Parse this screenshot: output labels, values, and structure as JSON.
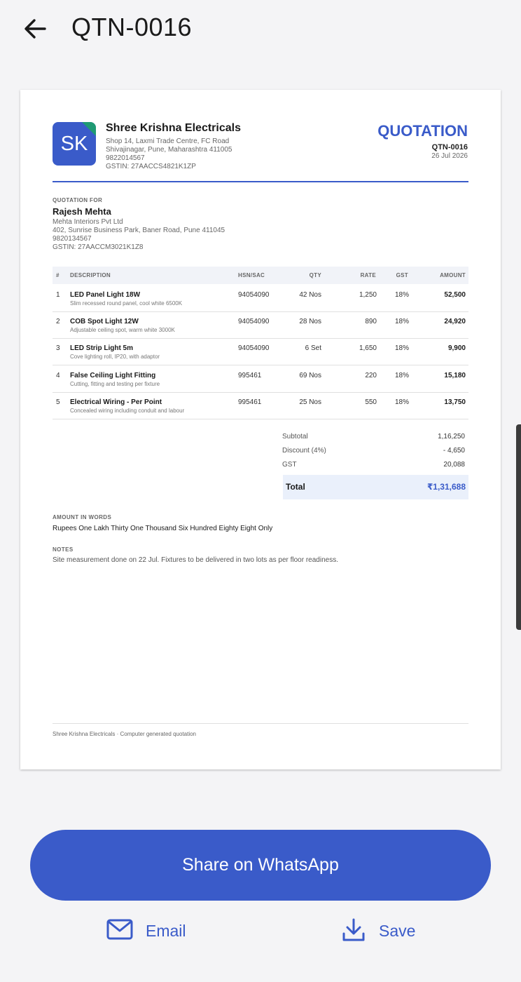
{
  "header": {
    "title": "QTN-0016"
  },
  "business": {
    "logo_text": "SK",
    "name": "Shree Krishna Electricals",
    "address1": "Shop 14, Laxmi Trade Centre, FC Road",
    "address2": "Shivajinagar, Pune, Maharashtra 411005",
    "phone": "9822014567",
    "gstin": "GSTIN: 27AACCS4821K1ZP"
  },
  "document": {
    "type": "QUOTATION",
    "number": "QTN-0016",
    "date": "26 Jul 2026"
  },
  "customer": {
    "label": "QUOTATION FOR",
    "name": "Rajesh Mehta",
    "company": "Mehta Interiors Pvt Ltd",
    "address": "402, Sunrise Business Park, Baner Road, Pune 411045",
    "phone": "9820134567",
    "gstin": "GSTIN: 27AACCM3021K1Z8"
  },
  "table": {
    "headers": {
      "no": "#",
      "desc": "DESCRIPTION",
      "hsn": "HSN/SAC",
      "qty": "QTY",
      "rate": "RATE",
      "gst": "GST",
      "amount": "AMOUNT"
    },
    "rows": [
      {
        "no": "1",
        "item": "LED Panel Light 18W",
        "desc": "Slim recessed round panel, cool white 6500K",
        "hsn": "94054090",
        "qty": "42 Nos",
        "rate": "1,250",
        "gst": "18%",
        "amount": "52,500"
      },
      {
        "no": "2",
        "item": "COB Spot Light 12W",
        "desc": "Adjustable ceiling spot, warm white 3000K",
        "hsn": "94054090",
        "qty": "28 Nos",
        "rate": "890",
        "gst": "18%",
        "amount": "24,920"
      },
      {
        "no": "3",
        "item": "LED Strip Light 5m",
        "desc": "Cove lighting roll, IP20, with adaptor",
        "hsn": "94054090",
        "qty": "6 Set",
        "rate": "1,650",
        "gst": "18%",
        "amount": "9,900"
      },
      {
        "no": "4",
        "item": "False Ceiling Light Fitting",
        "desc": "Cutting, fitting and testing per fixture",
        "hsn": "995461",
        "qty": "69 Nos",
        "rate": "220",
        "gst": "18%",
        "amount": "15,180"
      },
      {
        "no": "5",
        "item": "Electrical Wiring - Per Point",
        "desc": "Concealed wiring including conduit and labour",
        "hsn": "995461",
        "qty": "25 Nos",
        "rate": "550",
        "gst": "18%",
        "amount": "13,750"
      }
    ]
  },
  "totals": {
    "subtotal_label": "Subtotal",
    "subtotal": "1,16,250",
    "discount_label": "Discount (4%)",
    "discount": "- 4,650",
    "gst_label": "GST",
    "gst": "20,088",
    "total_label": "Total",
    "total": "₹1,31,688"
  },
  "words": {
    "label": "AMOUNT IN WORDS",
    "text": "Rupees One Lakh Thirty One Thousand Six Hundred Eighty Eight Only"
  },
  "notes": {
    "label": "NOTES",
    "text": "Site measurement done on 22 Jul. Fixtures to be delivered in two lots as per floor readiness."
  },
  "footer": {
    "text": "Shree Krishna Electricals · Computer generated quotation"
  },
  "actions": {
    "whatsapp": "Share on WhatsApp",
    "email": "Email",
    "save": "Save"
  },
  "icons": {
    "back": "arrow-left-icon",
    "email": "mail-icon",
    "save": "download-icon"
  },
  "colors": {
    "accent": "#3a5bc9",
    "logo_corner": "#1f9a73",
    "total_bg": "#eaf0fb"
  }
}
